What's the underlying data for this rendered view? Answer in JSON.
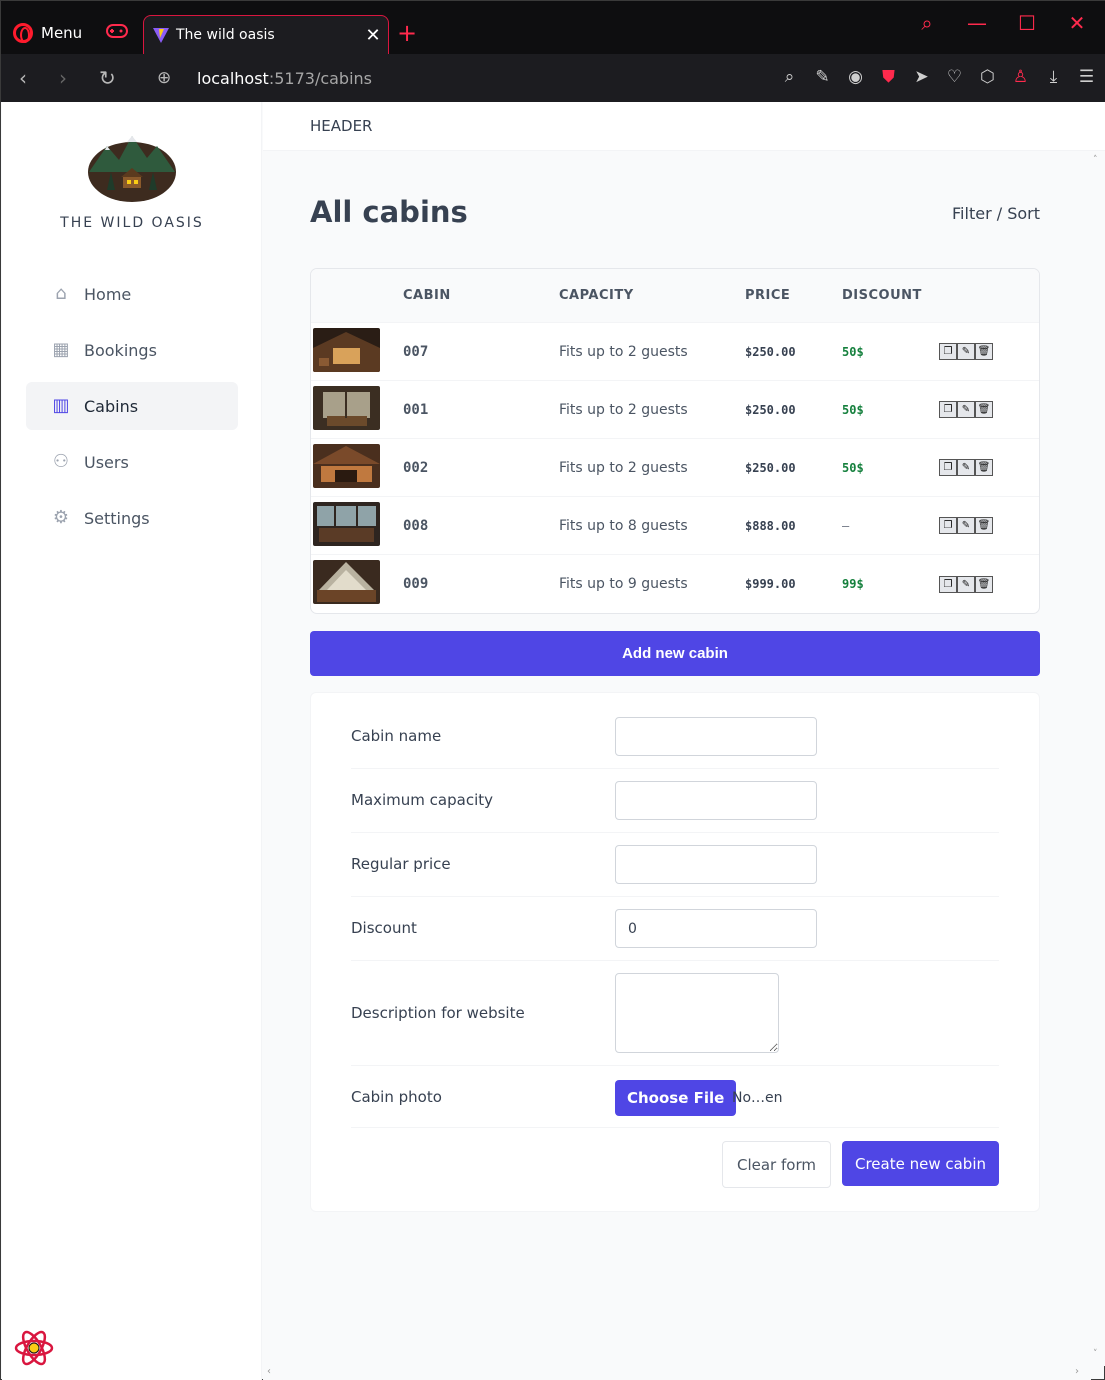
{
  "browser": {
    "menu_label": "Menu",
    "tab_title": "The wild oasis",
    "url_host": "localhost",
    "url_path": ":5173/cabins"
  },
  "colors": {
    "accent": "#4f46e5",
    "browser_red": "#ff2a4d",
    "discount_green": "#15803d"
  },
  "sidebar": {
    "brand": "THE WILD OASIS",
    "items": [
      {
        "label": "Home",
        "icon": "home-icon"
      },
      {
        "label": "Bookings",
        "icon": "calendar-icon"
      },
      {
        "label": "Cabins",
        "icon": "building-icon"
      },
      {
        "label": "Users",
        "icon": "users-icon"
      },
      {
        "label": "Settings",
        "icon": "gear-icon"
      }
    ],
    "active": "Cabins"
  },
  "header": {
    "text": "HEADER"
  },
  "main": {
    "title": "All cabins",
    "filter_sort": "Filter / Sort",
    "table": {
      "columns": [
        "",
        "CABIN",
        "CAPACITY",
        "PRICE",
        "DISCOUNT",
        ""
      ],
      "rows": [
        {
          "name": "007",
          "capacity": "Fits up to 2 guests",
          "price": "$250.00",
          "discount": "50$"
        },
        {
          "name": "001",
          "capacity": "Fits up to 2 guests",
          "price": "$250.00",
          "discount": "50$"
        },
        {
          "name": "002",
          "capacity": "Fits up to 2 guests",
          "price": "$250.00",
          "discount": "50$"
        },
        {
          "name": "008",
          "capacity": "Fits up to 8 guests",
          "price": "$888.00",
          "discount": "—"
        },
        {
          "name": "009",
          "capacity": "Fits up to 9 guests",
          "price": "$999.00",
          "discount": "99$"
        }
      ]
    },
    "add_button": "Add new cabin",
    "form": {
      "cabin_name_label": "Cabin name",
      "max_capacity_label": "Maximum capacity",
      "regular_price_label": "Regular price",
      "discount_label": "Discount",
      "discount_value": "0",
      "description_label": "Description for website",
      "photo_label": "Cabin photo",
      "choose_file": "Choose File",
      "file_name": "No…en",
      "clear_button": "Clear form",
      "create_button": "Create new cabin"
    }
  }
}
